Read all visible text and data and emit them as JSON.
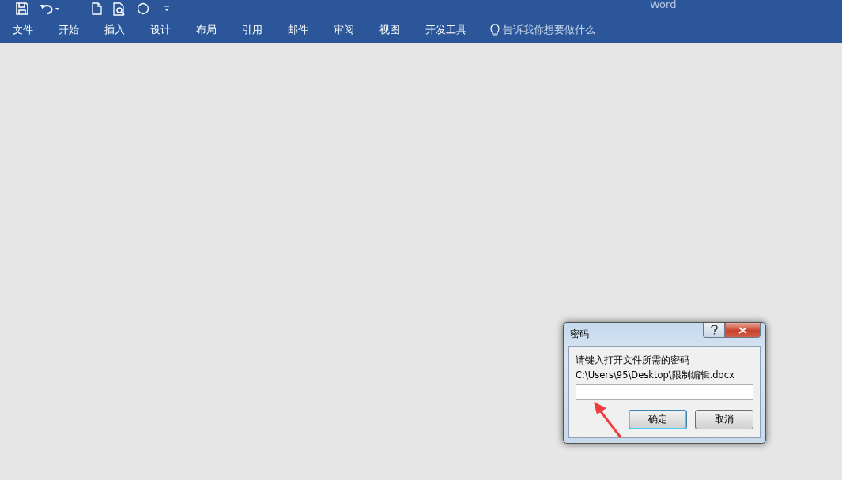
{
  "window": {
    "title": "Word"
  },
  "menu_tabs": [
    {
      "label": "文件"
    },
    {
      "label": "开始"
    },
    {
      "label": "插入"
    },
    {
      "label": "设计"
    },
    {
      "label": "布局"
    },
    {
      "label": "引用"
    },
    {
      "label": "邮件"
    },
    {
      "label": "审阅"
    },
    {
      "label": "视图"
    },
    {
      "label": "开发工具"
    }
  ],
  "tell_me": {
    "placeholder": "告诉我你想要做什么"
  },
  "dialog": {
    "title": "密码",
    "prompt": "请键入打开文件所需的密码",
    "path": "C:\\Users\\95\\Desktop\\限制编辑.docx",
    "buttons": [
      {
        "label": "确定",
        "default": true
      },
      {
        "label": "取消",
        "default": false
      }
    ]
  }
}
